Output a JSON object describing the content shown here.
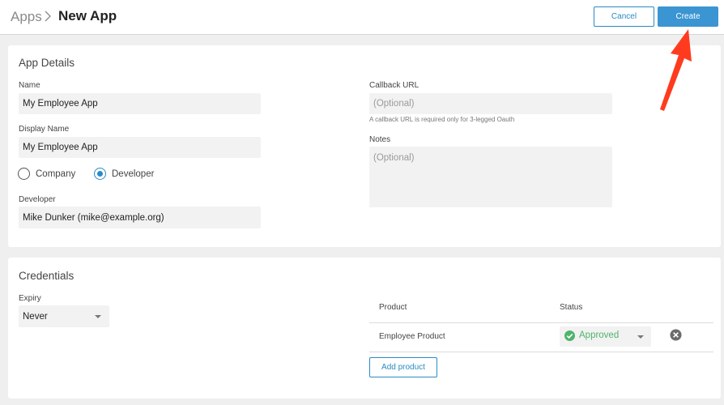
{
  "header": {
    "breadcrumb_parent": "Apps",
    "title": "New App",
    "cancel_label": "Cancel",
    "create_label": "Create"
  },
  "app_details": {
    "title": "App Details",
    "name_label": "Name",
    "name_value": "My Employee App",
    "display_name_label": "Display Name",
    "display_name_value": "My Employee App",
    "owner_options": [
      {
        "label": "Company",
        "selected": false
      },
      {
        "label": "Developer",
        "selected": true
      }
    ],
    "developer_label": "Developer",
    "developer_value": "Mike Dunker (mike@example.org)",
    "callback_label": "Callback URL",
    "callback_placeholder": "(Optional)",
    "callback_hint": "A callback URL is required only for 3-legged Oauth",
    "notes_label": "Notes",
    "notes_placeholder": "(Optional)"
  },
  "credentials": {
    "title": "Credentials",
    "expiry_label": "Expiry",
    "expiry_value": "Never",
    "table": {
      "columns": [
        "Product",
        "Status"
      ],
      "rows": [
        {
          "product": "Employee Product",
          "status": "Approved"
        }
      ]
    },
    "add_product_label": "Add product"
  },
  "colors": {
    "accent": "#2a8bc5",
    "primary_button": "#3b95d2",
    "approved": "#4db46b",
    "annotation_arrow": "#ff3b1f"
  },
  "icons": {
    "breadcrumb_separator": "chevron-right-icon",
    "status_check": "check-circle-icon",
    "remove": "close-circle-icon",
    "annotation": "arrow-annotation"
  }
}
